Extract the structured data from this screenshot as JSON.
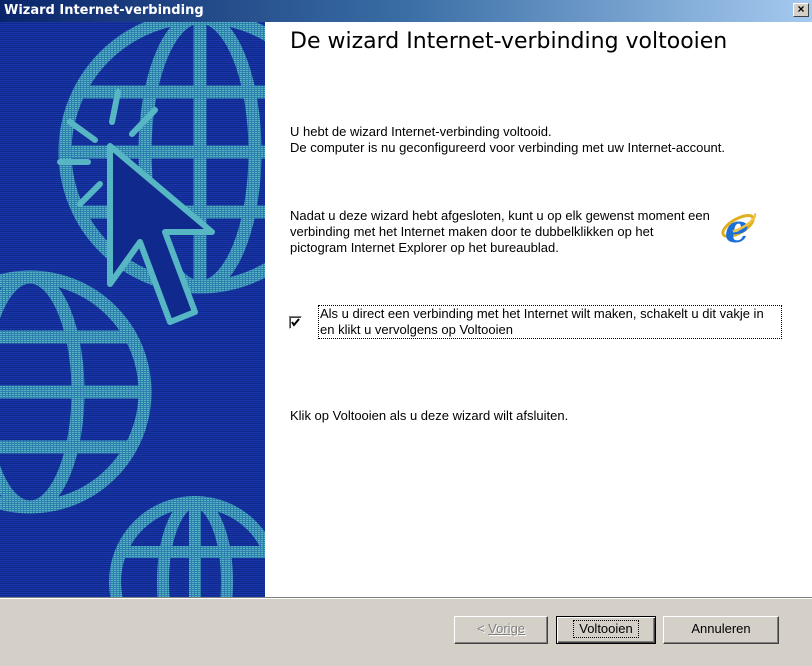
{
  "window": {
    "title": "Wizard Internet-verbinding",
    "close_glyph": "×"
  },
  "content": {
    "heading": "De wizard Internet-verbinding voltooien",
    "para1_line1": "U hebt de wizard Internet-verbinding voltooid.",
    "para1_line2": "De computer is nu geconfigureerd voor verbinding met uw Internet-account.",
    "para2": "Nadat u deze wizard hebt afgesloten, kunt u op elk gewenst moment een verbinding met het Internet maken door te dubbelklikken op het pictogram Internet Explorer op het bureaublad.",
    "checkbox_label": "Als u direct een verbinding met het Internet wilt maken, schakelt u dit vakje in en klikt u vervolgens op Voltooien",
    "checkbox_checked": true,
    "para3": "Klik op Voltooien als u deze wizard wilt afsluiten."
  },
  "buttons": {
    "back_prefix": "< ",
    "back_label": "Vorige",
    "finish_label": "Voltooien",
    "cancel_label": "Annuleren"
  },
  "icons": {
    "close": "close-icon",
    "ie": "internet-explorer-icon",
    "banner": "globe-cursor-illustration"
  },
  "colors": {
    "banner_bg": "#0f2a8c",
    "banner_art": "#4aa6b8",
    "title_start": "#0a246a",
    "title_end": "#a6caf0",
    "face": "#d4d0c8"
  }
}
